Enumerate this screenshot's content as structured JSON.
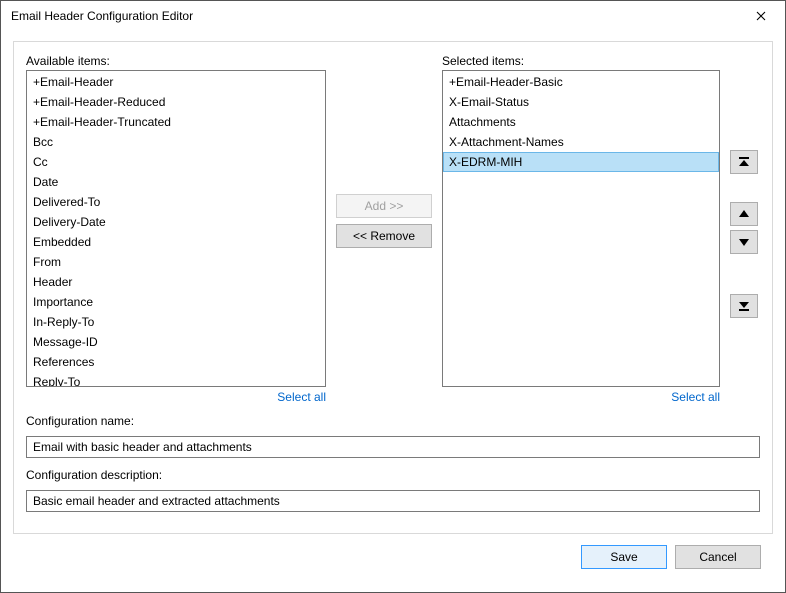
{
  "window": {
    "title": "Email Header Configuration Editor"
  },
  "labels": {
    "available": "Available items:",
    "selected": "Selected items:",
    "select_all": "Select all",
    "config_name": "Configuration name:",
    "config_desc": "Configuration description:"
  },
  "buttons": {
    "add": "Add >>",
    "remove": "<< Remove",
    "save": "Save",
    "cancel": "Cancel"
  },
  "available_items": [
    "+Email-Header",
    "+Email-Header-Reduced",
    "+Email-Header-Truncated",
    "Bcc",
    "Cc",
    "Date",
    "Delivered-To",
    "Delivery-Date",
    "Embedded",
    "From",
    "Header",
    "Importance",
    "In-Reply-To",
    "Message-ID",
    "References",
    "Reply-To"
  ],
  "selected_items": [
    {
      "label": "+Email-Header-Basic",
      "selected": false
    },
    {
      "label": "X-Email-Status",
      "selected": false
    },
    {
      "label": "Attachments",
      "selected": false
    },
    {
      "label": "X-Attachment-Names",
      "selected": false
    },
    {
      "label": "X-EDRM-MIH",
      "selected": true
    }
  ],
  "fields": {
    "config_name": "Email with basic header and attachments",
    "config_desc": "Basic email header and extracted attachments"
  },
  "state": {
    "add_enabled": false,
    "remove_enabled": true
  }
}
